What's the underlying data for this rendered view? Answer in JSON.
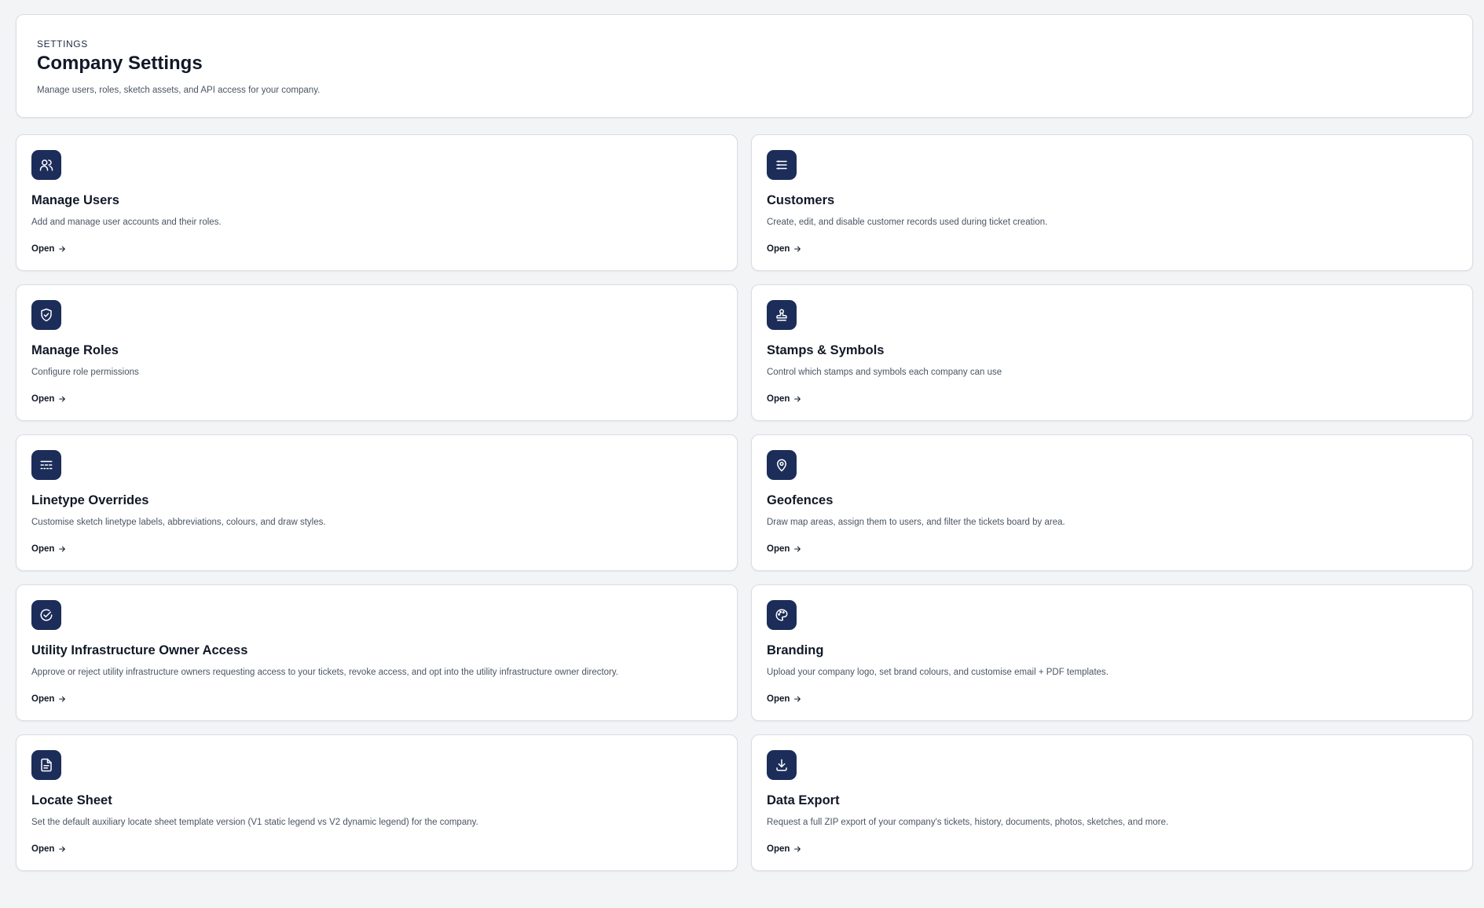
{
  "header": {
    "eyebrow": "SETTINGS",
    "title": "Company Settings",
    "subtitle": "Manage users, roles, sketch assets, and API access for your company."
  },
  "theme": {
    "icon_bg": "#1c2d5a",
    "card_border": "#d9dde3",
    "page_bg": "#f3f4f6"
  },
  "cards": [
    {
      "title": "Manage Users",
      "description": "Add and manage user accounts and their roles.",
      "link": "Open",
      "icon": "users-icon"
    },
    {
      "title": "Customers",
      "description": "Create, edit, and disable customer records used during ticket creation.",
      "link": "Open",
      "icon": "list-icon"
    },
    {
      "title": "Manage Roles",
      "description": "Configure role permissions",
      "link": "Open",
      "icon": "shield-check-icon"
    },
    {
      "title": "Stamps & Symbols",
      "description": "Control which stamps and symbols each company can use",
      "link": "Open",
      "icon": "stamp-icon"
    },
    {
      "title": "Linetype Overrides",
      "description": "Customise sketch linetype labels, abbreviations, colours, and draw styles.",
      "link": "Open",
      "icon": "linetype-icon"
    },
    {
      "title": "Geofences",
      "description": "Draw map areas, assign them to users, and filter the tickets board by area.",
      "link": "Open",
      "icon": "map-pin-icon"
    },
    {
      "title": "Utility Infrastructure Owner Access",
      "description": "Approve or reject utility infrastructure owners requesting access to your tickets, revoke access, and opt into the utility infrastructure owner directory.",
      "link": "Open",
      "icon": "circle-check-icon"
    },
    {
      "title": "Branding",
      "description": "Upload your company logo, set brand colours, and customise email + PDF templates.",
      "link": "Open",
      "icon": "palette-icon"
    },
    {
      "title": "Locate Sheet",
      "description": "Set the default auxiliary locate sheet template version (V1 static legend vs V2 dynamic legend) for the company.",
      "link": "Open",
      "icon": "file-text-icon"
    },
    {
      "title": "Data Export",
      "description": "Request a full ZIP export of your company's tickets, history, documents, photos, sketches, and more.",
      "link": "Open",
      "icon": "download-icon"
    }
  ]
}
